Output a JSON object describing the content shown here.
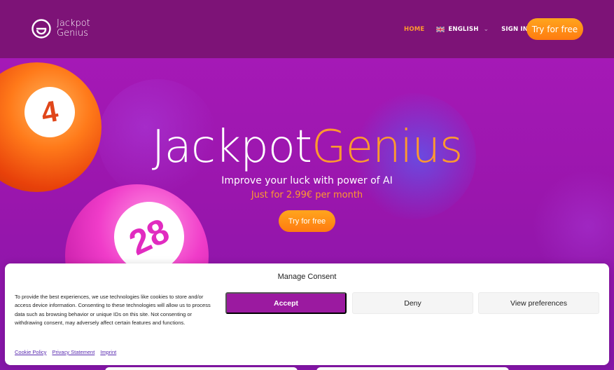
{
  "brand": {
    "line1": "Jackpot",
    "line2": "Genius"
  },
  "nav": {
    "home": "HOME",
    "language": "ENGLISH",
    "signin": "SIGN IN",
    "cta": "Try for free"
  },
  "hero": {
    "title_part1": "Jackpot",
    "title_part2": "Genius",
    "subtitle": "Improve your luck with power of AI",
    "price": "Just for 2.99€ per month",
    "cta": "Try for free",
    "ball_orange_number": "4",
    "ball_pink_number": "28"
  },
  "consent": {
    "title": "Manage Consent",
    "text": "To provide the best experiences, we use technologies like cookies to store and/or access device information. Consenting to these technologies will allow us to process data such as browsing behavior or unique IDs on this site. Not consenting or withdrawing consent, may adversely affect certain features and functions.",
    "accept": "Accept",
    "deny": "Deny",
    "preferences": "View preferences",
    "links": [
      "Cookie Policy",
      "Privacy Statement",
      "Imprint"
    ]
  },
  "colors": {
    "navbar": "#7d1377",
    "accent_orange": "#ff9a2e",
    "accept_purple": "#9b1aa0"
  },
  "icons": [
    "jackpot-genius-logo-icon",
    "uk-flag-icon",
    "chevron-down-icon"
  ]
}
